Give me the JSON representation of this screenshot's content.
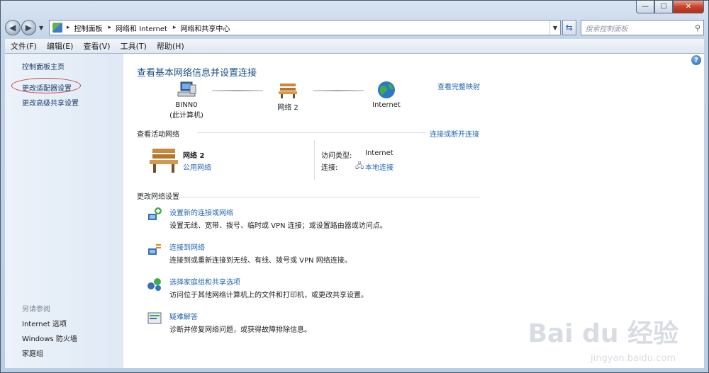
{
  "window": {
    "caption_buttons": [
      "—",
      "☐",
      "✕"
    ]
  },
  "address_bar": {
    "crumbs": [
      "控制面板",
      "网络和 Internet",
      "网络和共享中心"
    ],
    "search_placeholder": "搜索控制面板"
  },
  "menu": [
    "文件(F)",
    "编辑(E)",
    "查看(V)",
    "工具(T)",
    "帮助(H)"
  ],
  "sidebar": {
    "links": [
      "控制面板主页",
      "更改适配器设置",
      "更改高级共享设置"
    ],
    "see_also_title": "另请参阅",
    "see_also": [
      "Internet 选项",
      "Windows 防火墙",
      "家庭组"
    ]
  },
  "main": {
    "title": "查看基本网络信息并设置连接",
    "full_map": "查看完整映射",
    "map": {
      "computer_name": "BINN0",
      "computer_sub": "(此计算机)",
      "network_name": "网络  2",
      "internet": "Internet"
    },
    "active": {
      "label": "查看活动网络",
      "connect_link": "连接或断开连接",
      "network_name": "网络  2",
      "network_type": "公用网络",
      "access_type_label": "访问类型:",
      "access_type_value": "Internet",
      "connection_label": "连接:",
      "connection_value": "本地连接"
    },
    "settings_label": "更改网络设置",
    "tasks": [
      {
        "title": "设置新的连接或网络",
        "desc": "设置无线、宽带、拨号、临时或 VPN 连接；或设置路由器或访问点。"
      },
      {
        "title": "连接到网络",
        "desc": "连接到或重新连接到无线、有线、拨号或 VPN 网络连接。"
      },
      {
        "title": "选择家庭组和共享选项",
        "desc": "访问位于其他网络计算机上的文件和打印机，或更改共享设置。"
      },
      {
        "title": "疑难解答",
        "desc": "诊断并修复网络问题，或获得故障排除信息。"
      }
    ]
  },
  "watermark": {
    "brand": "Bai du 经验",
    "url": "jingyan.baidu.com"
  }
}
